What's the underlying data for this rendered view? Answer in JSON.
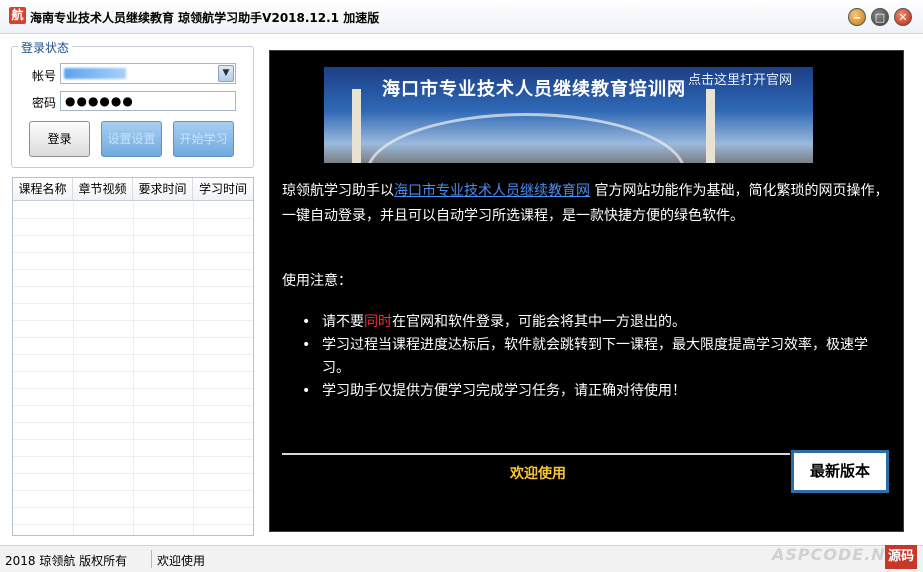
{
  "window": {
    "icon_glyph": "航",
    "title": "海南专业技术人员继续教育 琼领航学习助手V2018.12.1 加速版",
    "minimize": "‒",
    "maximize": "□",
    "close": "✕"
  },
  "login": {
    "group_title": "登录状态",
    "account_label": "帐号",
    "password_label": "密码",
    "password_value": "●●●●●●",
    "login_button": "登录",
    "settings_button": "设置设置",
    "start_button": "开始学习"
  },
  "course_table": {
    "columns": [
      "课程名称",
      "章节视频",
      "要求时间",
      "学习时间"
    ],
    "rows": []
  },
  "content": {
    "banner_title": "海口市专业技术人员继续教育培训网",
    "banner_link": "点击这里打开官网",
    "intro_prefix": "琼领航学习助手以",
    "intro_link": "海口市专业技术人员继续教育网",
    "intro_suffix": " 官方网站功能作为基础，简化繁琐的网页操作，一键自动登录，并且可以自动学习所选课程，是一款快捷方便的绿色软件。",
    "notes_title": "使用注意：",
    "note1_prefix": "请不要",
    "note1_red": "同时",
    "note1_suffix": "在官网和软件登录，可能会将其中一方退出的。",
    "note2": "学习过程当课程进度达标后，软件就会跳转到下一课程，最大限度提高学习效率，极速学习。",
    "note3": "学习助手仅提供方便学习完成学习任务，请正确对待使用！",
    "welcome": "欢迎使用",
    "latest_button": "最新版本"
  },
  "status": {
    "copyright": "2018 琼领航 版权所有",
    "message": "欢迎使用"
  },
  "watermark": {
    "text": "ASPCODE.NET",
    "badge": "源码"
  },
  "colors": {
    "accent_blue": "#2d6ea6",
    "link_blue": "#4b8cf0",
    "welcome_gold": "#f7c634",
    "warning_red": "#ff2a2a"
  }
}
